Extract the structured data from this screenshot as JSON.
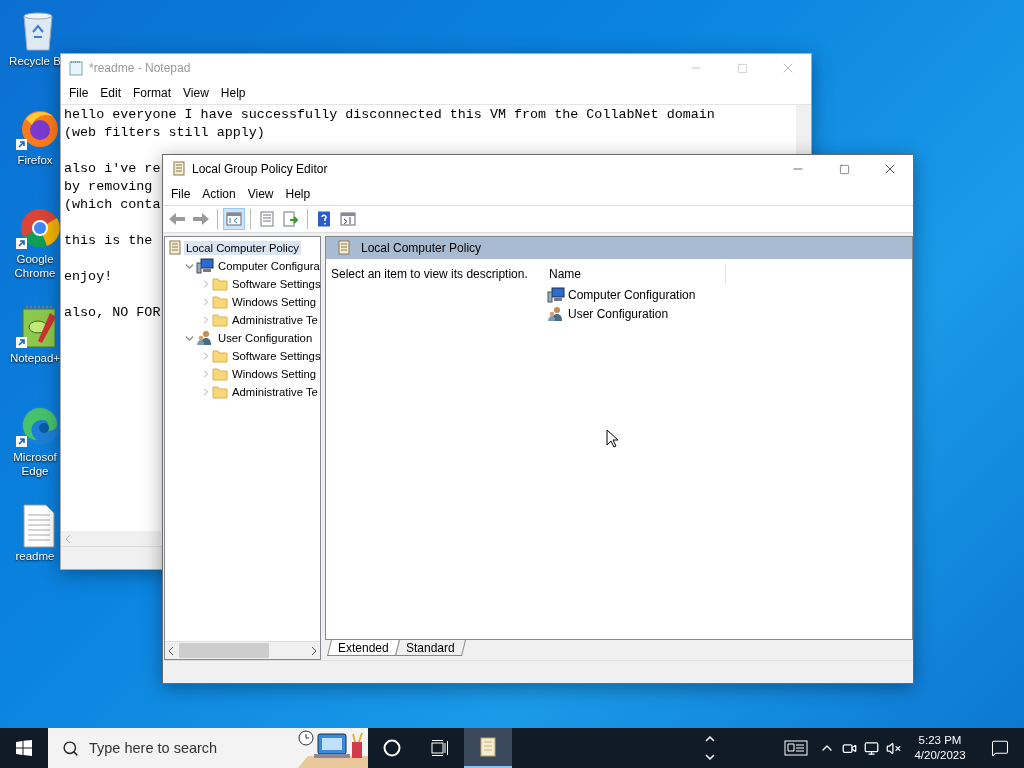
{
  "desktop_icons": [
    {
      "label": "Recycle B",
      "kind": "recycle"
    },
    {
      "label": "Firefox",
      "kind": "firefox"
    },
    {
      "label": "Google Chrome",
      "kind": "chrome"
    },
    {
      "label": "Notepad+",
      "kind": "notepadpp"
    },
    {
      "label": "Microsof Edge",
      "kind": "edge"
    },
    {
      "label": "readme",
      "kind": "document"
    }
  ],
  "notepad": {
    "title": "*readme - Notepad",
    "active": false,
    "menu": [
      "File",
      "Edit",
      "Format",
      "View",
      "Help"
    ],
    "paragraphs": [
      [
        "hello everyone I have successfully disconnected this VM from the CollabNet domain",
        "(web filters still apply)"
      ],
      [
        "also i've re",
        "by removing ",
        "(which conta"
      ],
      [
        "this is the "
      ],
      [
        "enjoy!"
      ],
      [
        "also, NO FOR"
      ]
    ]
  },
  "gpe": {
    "title": "Local Group Policy Editor",
    "active": true,
    "menu": [
      "File",
      "Action",
      "View",
      "Help"
    ],
    "toolbar": [
      [
        {
          "kind": "back",
          "pressed": false
        },
        {
          "kind": "forward",
          "pressed": false
        }
      ],
      [
        {
          "kind": "tree",
          "pressed": true
        }
      ],
      [
        {
          "kind": "properties",
          "pressed": false
        },
        {
          "kind": "export",
          "pressed": false
        }
      ],
      [
        {
          "kind": "help",
          "pressed": false
        },
        {
          "kind": "actionpane",
          "pressed": false
        }
      ]
    ],
    "tree": {
      "label": "Local Computer Policy",
      "kind": "policy",
      "selected": true,
      "children": [
        {
          "label": "Computer Configura",
          "kind": "computer",
          "selected": false,
          "expanded": true,
          "children": [
            {
              "label": "Software Settings",
              "kind": "folder",
              "selected": false,
              "expanded": false
            },
            {
              "label": "Windows Setting",
              "kind": "folder",
              "selected": false,
              "expanded": false
            },
            {
              "label": "Administrative Te",
              "kind": "folder",
              "selected": false,
              "expanded": false
            }
          ]
        },
        {
          "label": "User Configuration",
          "kind": "user",
          "selected": false,
          "expanded": true,
          "children": [
            {
              "label": "Software Settings",
              "kind": "folder",
              "selected": false,
              "expanded": false
            },
            {
              "label": "Windows Setting",
              "kind": "folder",
              "selected": false,
              "expanded": false
            },
            {
              "label": "Administrative Te",
              "kind": "folder",
              "selected": false,
              "expanded": false
            }
          ]
        }
      ]
    },
    "header": "Local Computer Policy",
    "description": "Select an item to view its description.",
    "columns": [
      "Name"
    ],
    "items": [
      {
        "label": "Computer Configuration",
        "kind": "computer"
      },
      {
        "label": "User Configuration",
        "kind": "user"
      }
    ],
    "tabs": [
      {
        "label": "Extended",
        "selected": true
      },
      {
        "label": "Standard",
        "selected": false
      }
    ]
  },
  "taskbar": {
    "search": {
      "placeholder": "Type here to search"
    },
    "apps": [
      {
        "kind": "gpe",
        "active": true
      }
    ],
    "time": "5:23 PM",
    "date": "4/20/2023"
  }
}
